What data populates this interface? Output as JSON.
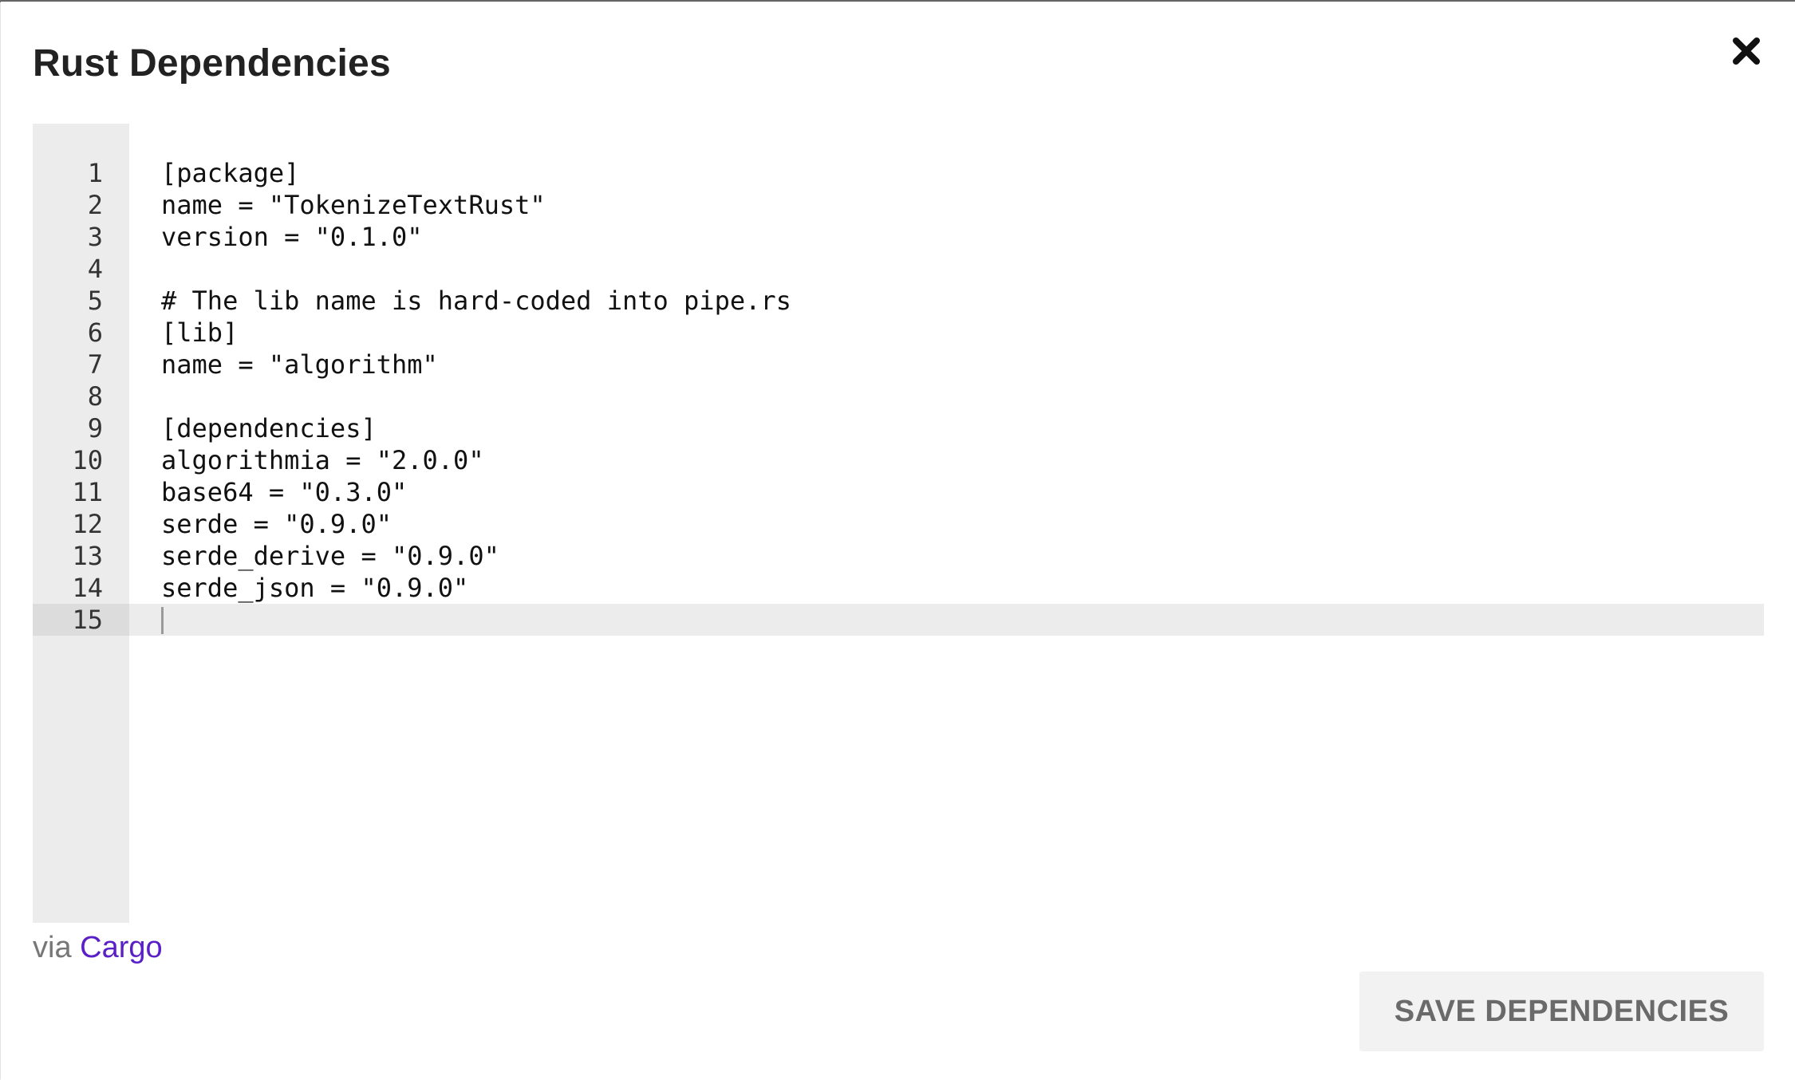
{
  "dialog": {
    "title": "Rust Dependencies",
    "close_icon": "close-icon"
  },
  "editor": {
    "active_line": 15,
    "lines": [
      {
        "number": "1",
        "text": "[package]"
      },
      {
        "number": "2",
        "text": "name = \"TokenizeTextRust\""
      },
      {
        "number": "3",
        "text": "version = \"0.1.0\""
      },
      {
        "number": "4",
        "text": ""
      },
      {
        "number": "5",
        "text": "# The lib name is hard-coded into pipe.rs"
      },
      {
        "number": "6",
        "text": "[lib]"
      },
      {
        "number": "7",
        "text": "name = \"algorithm\""
      },
      {
        "number": "8",
        "text": ""
      },
      {
        "number": "9",
        "text": "[dependencies]"
      },
      {
        "number": "10",
        "text": "algorithmia = \"2.0.0\""
      },
      {
        "number": "11",
        "text": "base64 = \"0.3.0\""
      },
      {
        "number": "12",
        "text": "serde = \"0.9.0\""
      },
      {
        "number": "13",
        "text": "serde_derive = \"0.9.0\""
      },
      {
        "number": "14",
        "text": "serde_json = \"0.9.0\""
      },
      {
        "number": "15",
        "text": ""
      }
    ]
  },
  "footer": {
    "via_text": "via",
    "link_label": "Cargo",
    "save_label": "SAVE DEPENDENCIES"
  },
  "colors": {
    "link": "#5a1fc7",
    "gutter": "#ececec",
    "button_bg": "#f2f2f2",
    "button_text": "#6a6a6a"
  }
}
